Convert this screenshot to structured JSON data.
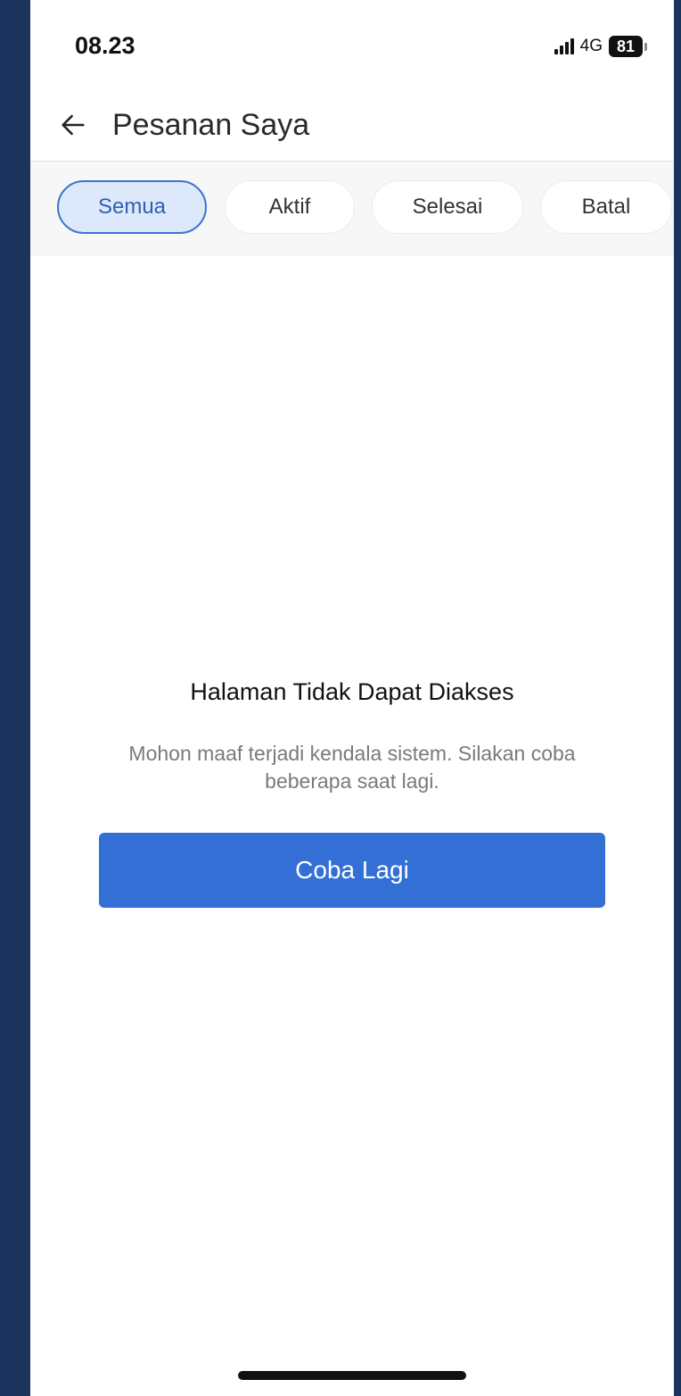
{
  "status_bar": {
    "time": "08.23",
    "network": "4G",
    "battery": "81"
  },
  "header": {
    "title": "Pesanan Saya",
    "back_icon": "arrow-left-icon"
  },
  "tabs": [
    {
      "label": "Semua",
      "active": true
    },
    {
      "label": "Aktif",
      "active": false
    },
    {
      "label": "Selesai",
      "active": false
    },
    {
      "label": "Batal",
      "active": false
    }
  ],
  "empty_state": {
    "title": "Halaman Tidak Dapat Diakses",
    "message": "Mohon maaf terjadi kendala sistem. Silakan coba beberapa saat lagi.",
    "retry_label": "Coba Lagi"
  },
  "colors": {
    "accent": "#346fd5",
    "tab_active_bg": "#dde9fb",
    "tab_active_border": "#3d73cf",
    "outer_frame": "#1c335e"
  }
}
